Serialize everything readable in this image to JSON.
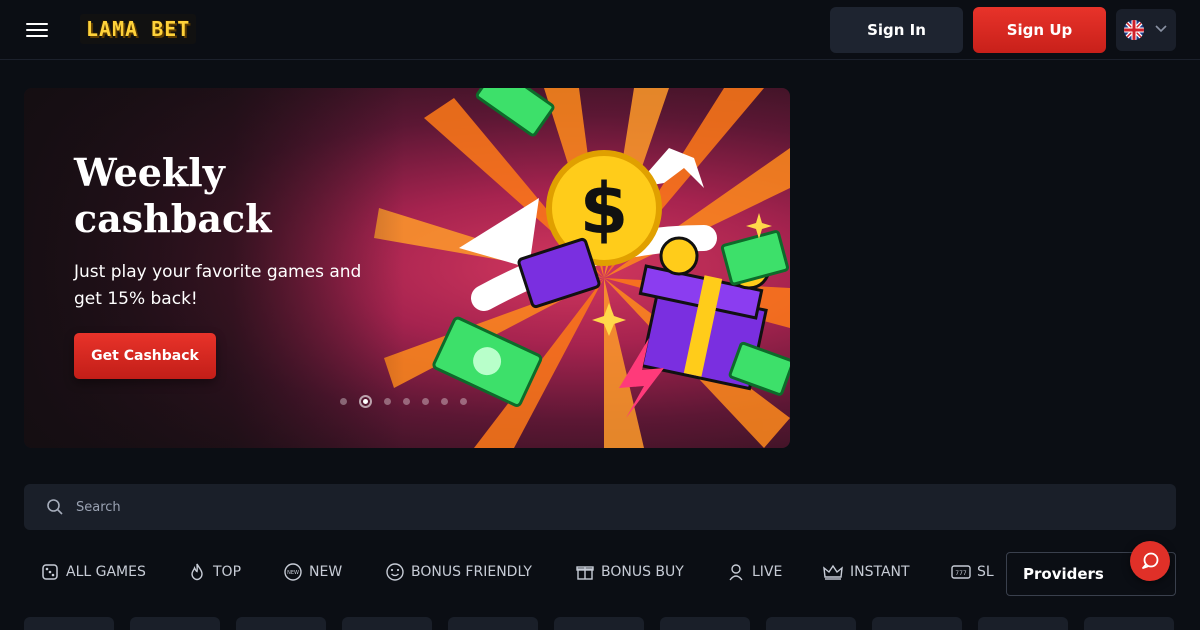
{
  "header": {
    "logo_text": "LAMA BET",
    "signin_label": "Sign In",
    "signup_label": "Sign Up",
    "language": "en-GB"
  },
  "banner": {
    "title": "Weekly cashback",
    "subtitle": "Just play your favorite games and get 15% back!",
    "cta_label": "Get Cashback",
    "slide_count": 7,
    "active_slide": 2
  },
  "search": {
    "placeholder": "Search"
  },
  "categories": [
    {
      "label": "ALL GAMES",
      "icon": "dice-icon"
    },
    {
      "label": "TOP",
      "icon": "flame-icon"
    },
    {
      "label": "NEW",
      "icon": "new-badge-icon"
    },
    {
      "label": "BONUS FRIENDLY",
      "icon": "smiley-icon"
    },
    {
      "label": "BONUS BUY",
      "icon": "gift-icon"
    },
    {
      "label": "LIVE",
      "icon": "dealer-icon"
    },
    {
      "label": "INSTANT",
      "icon": "crown-icon"
    },
    {
      "label": "SL",
      "icon": "slots-777-icon"
    }
  ],
  "providers_label": "Providers",
  "colors": {
    "accent": "#e03028",
    "background": "#0b0e14",
    "surface": "#1a1f29"
  }
}
